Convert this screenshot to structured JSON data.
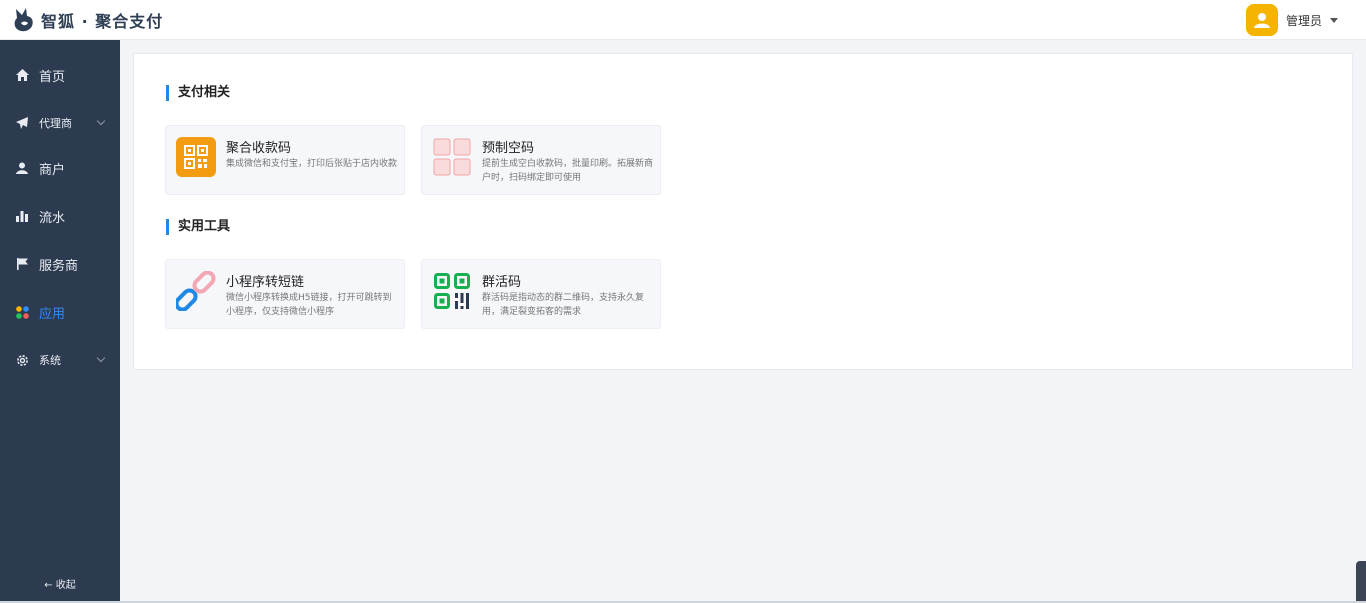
{
  "brand": {
    "name": "智狐 · 聚合支付"
  },
  "user": {
    "name": "管理员"
  },
  "sidebar": {
    "items": [
      {
        "label": "首页",
        "icon": "home-icon"
      },
      {
        "label": "代理商",
        "icon": "paper-plane-icon"
      },
      {
        "label": "商户",
        "icon": "user-icon"
      },
      {
        "label": "流水",
        "icon": "bar-chart-icon"
      },
      {
        "label": "服务商",
        "icon": "flag-icon"
      },
      {
        "label": "应用",
        "icon": "apps-icon"
      },
      {
        "label": "系统",
        "icon": "gear-icon"
      }
    ],
    "collapse_label": "收起"
  },
  "sections": [
    {
      "title": "支付相关",
      "cards": [
        {
          "title": "聚合收款码",
          "desc": "集成微信和支付宝，打印后张贴于店内收款"
        },
        {
          "title": "预制空码",
          "desc": "提前生成空白收款码，批量印刷。拓展新商户时，扫码绑定即可使用"
        }
      ]
    },
    {
      "title": "实用工具",
      "cards": [
        {
          "title": "小程序转短链",
          "desc": "微信小程序转换成H5链接，打开可跳转到小程序，仅支持微信小程序"
        },
        {
          "title": "群活码",
          "desc": "群活码是指动态的群二维码，支持永久复用，满足裂变拓客的需求"
        }
      ]
    }
  ],
  "colors": {
    "accent": "#2f8cff",
    "sidebar_bg": "#2d3b50",
    "section_bar": "#1e88e5"
  }
}
